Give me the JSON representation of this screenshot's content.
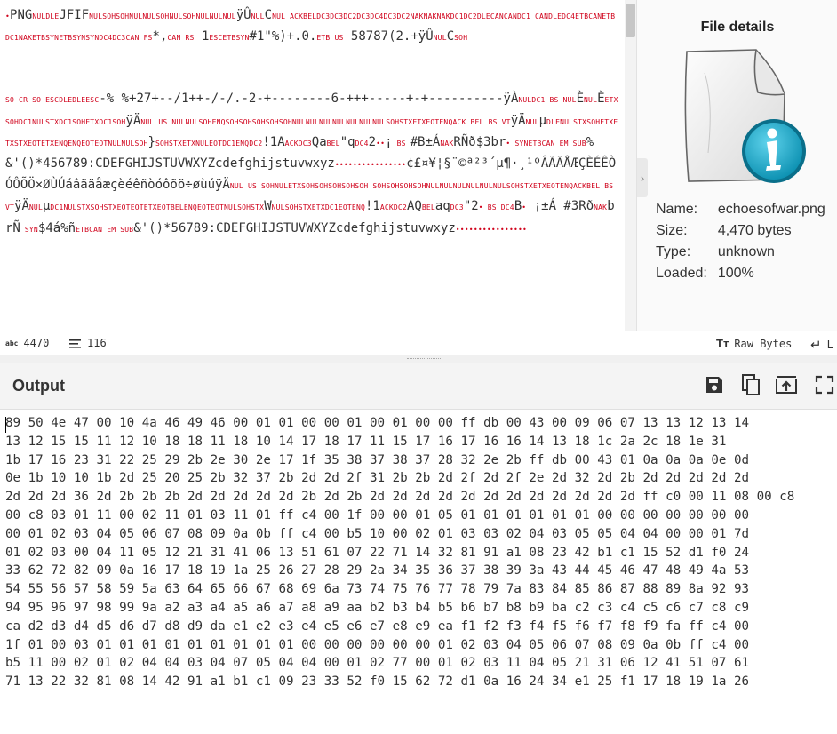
{
  "input": {
    "segments": [
      {
        "t": "c",
        "v": "•"
      },
      {
        "t": "x",
        "v": "PNG"
      },
      {
        "t": "c",
        "v": "NULDLE"
      },
      {
        "t": "x",
        "v": "JFIF"
      },
      {
        "t": "c",
        "v": "NULSOHSOHNULNULSOHNULSOHNULNULNUL"
      },
      {
        "t": "x",
        "v": "ÿÛ"
      },
      {
        "t": "c",
        "v": "NUL"
      },
      {
        "t": "x",
        "v": "C"
      },
      {
        "t": "c",
        "v": "NUL    ACKBELDC3DC3DC2DC3DC4DC3DC2NAKNAKNAKDC1DC2DLECANCANDC1 CANDLEDC4ETBCANETBDC1NAKETBSYNETBSYNSYNDC4DC3CAN FS"
      },
      {
        "t": "x",
        "v": "*,"
      },
      {
        "t": "c",
        "v": "CAN RS"
      },
      {
        "t": "x",
        "v": " 1"
      },
      {
        "t": "c",
        "v": "ESCETBSYN"
      },
      {
        "t": "x",
        "v": "#1\"%)+.0."
      },
      {
        "t": "c",
        "v": "ETB US"
      },
      {
        "t": "x",
        "v": " 58787(2.+ÿÛ"
      },
      {
        "t": "c",
        "v": "NUL"
      },
      {
        "t": "x",
        "v": "C"
      },
      {
        "t": "c",
        "v": "SOH"
      },
      {
        "t": "g",
        "v": ""
      },
      {
        "t": "c",
        "v": "SO CR SO ESCDLEDLEESC"
      },
      {
        "t": "x",
        "v": "-% %+27+--/1++-/-/.-2-+--------6-+++-----+-+----------ÿÀ"
      },
      {
        "t": "c",
        "v": "NULDC1 BS NUL"
      },
      {
        "t": "x",
        "v": "È"
      },
      {
        "t": "c",
        "v": "NUL"
      },
      {
        "t": "x",
        "v": "È"
      },
      {
        "t": "c",
        "v": "ETXSOHDC1NULSTXDC1SOHETXDC1SOH"
      },
      {
        "t": "x",
        "v": "ÿÄ"
      },
      {
        "t": "c",
        "v": "NUL US NULNULSOHENQSOHSOHSOHSOHSOHNULNULNULNULNULNULNULSOHSTXETXEOTENQACK BEL BS"
      },
      {
        "t": "c",
        "v": " VT"
      },
      {
        "t": "x",
        "v": "ÿÄ"
      },
      {
        "t": "c",
        "v": "NUL"
      },
      {
        "t": "x",
        "v": "µ"
      },
      {
        "t": "c",
        "v": "DLENULSTXSOHETXETXSTXEOTETXENQENQEOTEOTNULNULSOH"
      },
      {
        "t": "x",
        "v": "}"
      },
      {
        "t": "c",
        "v": "SOHSTXETXNULEOTDC1ENQDC2"
      },
      {
        "t": "x",
        "v": "!1A"
      },
      {
        "t": "c",
        "v": "ACKDC3"
      },
      {
        "t": "x",
        "v": "Qa"
      },
      {
        "t": "c",
        "v": "BEL"
      },
      {
        "t": "x",
        "v": "\"q"
      },
      {
        "t": "c",
        "v": "DC4"
      },
      {
        "t": "x",
        "v": "2"
      },
      {
        "t": "c",
        "v": "••"
      },
      {
        "t": "x",
        "v": "¡"
      },
      {
        "t": "c",
        "v": " BS "
      },
      {
        "t": "x",
        "v": "#B±Á"
      },
      {
        "t": "c",
        "v": "NAK"
      },
      {
        "t": "x",
        "v": "RÑð$3br"
      },
      {
        "t": "c",
        "v": "•"
      },
      {
        "t": "c",
        "v": " SYNETBCAN EM SUB"
      },
      {
        "t": "x",
        "v": "%&'()*456789:CDEFGHIJSTUVWXYZcdefghijstuvwxyz"
      },
      {
        "t": "c",
        "v": "••••••••••••••••"
      },
      {
        "t": "x",
        "v": "¢£¤¥¦§¨©ª²³´µ¶·¸¹ºÂÃÄÅÆÇÈÉÊÒÓÔÕÖ×ØÙÚáâãäåæçèéêñòóôõö÷øùúÿÄ"
      },
      {
        "t": "c",
        "v": "NUL US SOHNULETXSOHSOHSOHSOHSOH SOHSOHSOHSOHNULNULNULNULNULNULSOHSTXETXEOTENQACKBEL BS"
      },
      {
        "t": "c",
        "v": " VT"
      },
      {
        "t": "x",
        "v": "ÿÄ"
      },
      {
        "t": "c",
        "v": "NUL"
      },
      {
        "t": "x",
        "v": "µ"
      },
      {
        "t": "c",
        "v": "DC1NULSTXSOHSTXEOTEOTETXEOTBELENQEOTEOTNULSOHSTX"
      },
      {
        "t": "x",
        "v": "W"
      },
      {
        "t": "c",
        "v": "NULSOHSTXETXDC1EOTENQ"
      },
      {
        "t": "x",
        "v": "!1"
      },
      {
        "t": "c",
        "v": "ACKDC2"
      },
      {
        "t": "x",
        "v": "AQ"
      },
      {
        "t": "c",
        "v": "BEL"
      },
      {
        "t": "x",
        "v": "aq"
      },
      {
        "t": "c",
        "v": "DC3"
      },
      {
        "t": "x",
        "v": "\"2"
      },
      {
        "t": "c",
        "v": "• BS DC4"
      },
      {
        "t": "x",
        "v": "B"
      },
      {
        "t": "c",
        "v": "•"
      },
      {
        "t": "x",
        "v": " ¡±Á #3Rð"
      },
      {
        "t": "c",
        "v": "NAK"
      },
      {
        "t": "x",
        "v": "brÑ"
      },
      {
        "t": "c",
        "v": " SYN"
      },
      {
        "t": "x",
        "v": "$4á%ñ"
      },
      {
        "t": "c",
        "v": "ETBCAN EM SUB"
      },
      {
        "t": "x",
        "v": "&'()*56789:CDEFGHIJSTUVWXYZcdefghijstuvwxyz"
      },
      {
        "t": "c",
        "v": "••••••••••••••••"
      }
    ]
  },
  "details": {
    "title": "File details",
    "rows": [
      {
        "label": "Name:",
        "value": "echoesofwar.png"
      },
      {
        "label": "Size:",
        "value": "4,470 bytes"
      },
      {
        "label": "Type:",
        "value": "unknown"
      },
      {
        "label": "Loaded:",
        "value": "100%"
      }
    ]
  },
  "input_status": {
    "length_icon": "abc",
    "length": "4470",
    "lines": "116",
    "raw_bytes_label": "Raw Bytes",
    "raw_bytes_icon_glyph": "Tт",
    "eol_glyph": "↵",
    "eol_label": "L"
  },
  "output": {
    "title": "Output",
    "lines": [
      "89 50 4e 47 00 10 4a 46 49 46 00 01 01 00 00 01 00 01 00 00 ff db 00 43 00 09 06 07 13 13 12 13 14",
      "13 12 15 15 11 12 10 18 18 11 18 10 14 17 18 17 11 15 17 16 17 16 16 14 13 18 1c 2a 2c 18 1e 31",
      "1b 17 16 23 31 22 25 29 2b 2e 30 2e 17 1f 35 38 37 38 37 28 32 2e 2b ff db 00 43 01 0a 0a 0a 0e 0d",
      "0e 1b 10 10 1b 2d 25 20 25 2b 32 37 2b 2d 2d 2f 31 2b 2b 2d 2f 2d 2f 2e 2d 32 2d 2b 2d 2d 2d 2d 2d",
      "2d 2d 2d 36 2d 2b 2b 2b 2d 2d 2d 2d 2d 2b 2d 2b 2d 2d 2d 2d 2d 2d 2d 2d 2d 2d 2d 2d ff c0 00 11 08 00 c8",
      "00 c8 03 01 11 00 02 11 01 03 11 01 ff c4 00 1f 00 00 01 05 01 01 01 01 01 01 00 00 00 00 00 00 00",
      "00 01 02 03 04 05 06 07 08 09 0a 0b ff c4 00 b5 10 00 02 01 03 03 02 04 03 05 05 04 04 00 00 01 7d",
      "01 02 03 00 04 11 05 12 21 31 41 06 13 51 61 07 22 71 14 32 81 91 a1 08 23 42 b1 c1 15 52 d1 f0 24",
      "33 62 72 82 09 0a 16 17 18 19 1a 25 26 27 28 29 2a 34 35 36 37 38 39 3a 43 44 45 46 47 48 49 4a 53",
      "54 55 56 57 58 59 5a 63 64 65 66 67 68 69 6a 73 74 75 76 77 78 79 7a 83 84 85 86 87 88 89 8a 92 93",
      "94 95 96 97 98 99 9a a2 a3 a4 a5 a6 a7 a8 a9 aa b2 b3 b4 b5 b6 b7 b8 b9 ba c2 c3 c4 c5 c6 c7 c8 c9",
      "ca d2 d3 d4 d5 d6 d7 d8 d9 da e1 e2 e3 e4 e5 e6 e7 e8 e9 ea f1 f2 f3 f4 f5 f6 f7 f8 f9 fa ff c4 00",
      "1f 01 00 03 01 01 01 01 01 01 01 01 01 00 00 00 00 00 00 01 02 03 04 05 06 07 08 09 0a 0b ff c4 00",
      "b5 11 00 02 01 02 04 04 03 04 07 05 04 04 00 01 02 77 00 01 02 03 11 04 05 21 31 06 12 41 51 07 61",
      "71 13 22 32 81 08 14 42 91 a1 b1 c1 09 23 33 52 f0 15 62 72 d1 0a 16 24 34 e1 25 f1 17 18 19 1a 26"
    ]
  }
}
